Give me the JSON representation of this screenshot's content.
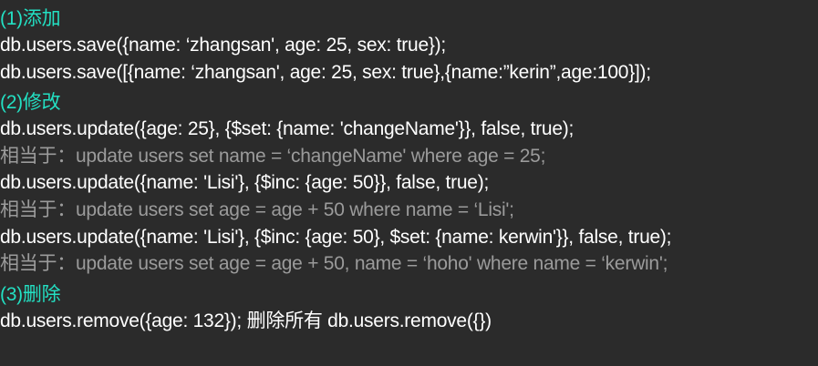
{
  "sections": [
    {
      "heading": "(1)添加",
      "lines": [
        {
          "kind": "code",
          "text": "db.users.save({name: ‘zhangsan', age: 25, sex: true});"
        },
        {
          "kind": "code",
          "text": "db.users.save([{name: ‘zhangsan', age: 25, sex: true},{name:”kerin”,age:100}]);"
        }
      ]
    },
    {
      "heading": "(2)修改",
      "lines": [
        {
          "kind": "code",
          "text": "db.users.update({age: 25}, {$set: {name: 'changeName'}}, false, true);"
        },
        {
          "kind": "comment",
          "text": "相当于：update users set name = ‘changeName' where age = 25;"
        },
        {
          "kind": "code",
          "text": "db.users.update({name: 'Lisi'}, {$inc: {age: 50}}, false, true);"
        },
        {
          "kind": "comment",
          "text": "相当于：update users set age = age + 50 where name = ‘Lisi';"
        },
        {
          "kind": "code",
          "text": "db.users.update({name: 'Lisi'}, {$inc: {age: 50}, $set: {name: kerwin'}}, false, true);"
        },
        {
          "kind": "comment",
          "text": "相当于：update users set age = age + 50, name = ‘hoho' where name = ‘kerwin';"
        }
      ]
    },
    {
      "heading": "(3)删除",
      "lines": [
        {
          "kind": "code",
          "text": "db.users.remove({age: 132});  删除所有 db.users.remove({})"
        }
      ]
    }
  ]
}
